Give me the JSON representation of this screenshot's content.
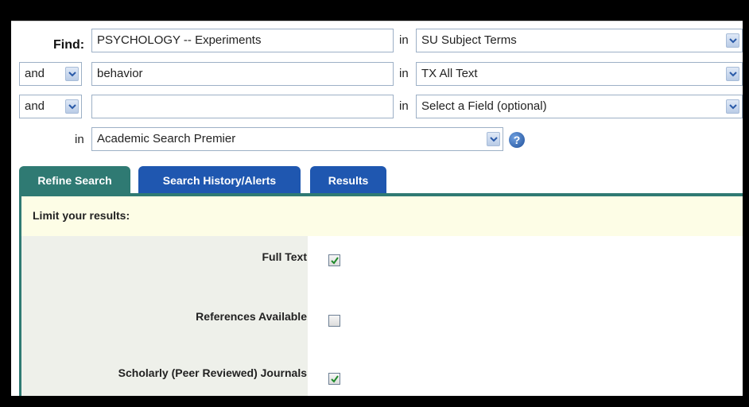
{
  "search": {
    "find_label": "Find:",
    "rows": [
      {
        "term": "PSYCHOLOGY -- Experiments",
        "in_label": "in",
        "field": "SU Subject Terms"
      },
      {
        "bool": "and",
        "term": "behavior",
        "in_label": "in",
        "field": "TX All Text"
      },
      {
        "bool": "and",
        "term": "",
        "in_label": "in",
        "field": "Select a Field (optional)"
      }
    ],
    "database_in_label": "in",
    "database": "Academic Search Premier",
    "help_glyph": "?"
  },
  "tabs": [
    {
      "label": "Refine Search",
      "active": true
    },
    {
      "label": "Search History/Alerts",
      "active": false
    },
    {
      "label": "Results",
      "active": false
    }
  ],
  "refine": {
    "heading": "Limit your results:",
    "options": [
      {
        "label": "Full Text",
        "checked": true
      },
      {
        "label": "References Available",
        "checked": false
      },
      {
        "label": "Scholarly (Peer Reviewed) Journals",
        "checked": true
      }
    ]
  },
  "colors": {
    "tab_active": "#2f7a73",
    "tab_inactive": "#1f57b0",
    "limit_bar": "#fdfde6",
    "label_column": "#eef0ea"
  }
}
